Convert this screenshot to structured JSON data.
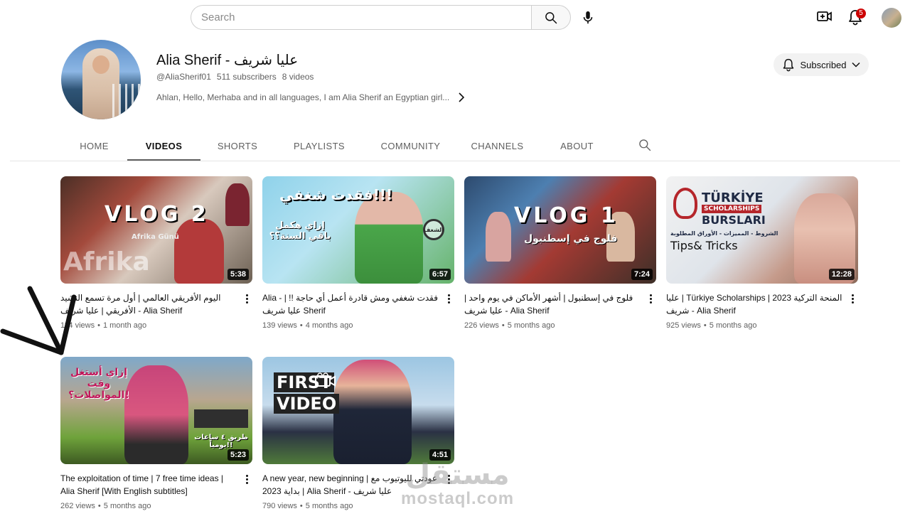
{
  "topbar": {
    "search_placeholder": "Search",
    "notification_count": "5",
    "icons": [
      "search-icon",
      "microphone-icon",
      "create-video-icon",
      "bell-icon",
      "avatar"
    ]
  },
  "channel": {
    "name": "Alia Sherif - عليا شريف",
    "handle": "@AliaSherif01",
    "subscribers": "511 subscribers",
    "videos_count": "8 videos",
    "description": "Ahlan, Hello, Merhaba and in all languages, I am Alia Sherif an Egyptian girl...",
    "subscribe_label": "Subscribed"
  },
  "tabs": [
    {
      "label": "HOME"
    },
    {
      "label": "VIDEOS"
    },
    {
      "label": "SHORTS"
    },
    {
      "label": "PLAYLISTS"
    },
    {
      "label": "COMMUNITY"
    },
    {
      "label": "CHANNELS"
    },
    {
      "label": "ABOUT"
    }
  ],
  "active_tab": "VIDEOS",
  "videos": [
    {
      "title": "اليوم الأفريقي العالمي | أول مرة تسمع النشيد الأفريقي | عليا شريف - Alia Sherif",
      "views": "114 views",
      "age": "1 month ago",
      "duration": "5:38",
      "thumb_text": [
        "VLOG 2",
        "Afrika",
        "Afrika Günü"
      ]
    },
    {
      "title": "Alia - فقدت شغفي ومش قادرة أعمل أي حاجة !! | عليا شريف Sherif",
      "views": "139 views",
      "age": "4 months ago",
      "duration": "6:57",
      "thumb_text": [
        "فقدت شغفي!!!",
        "إزاي هكمل باقي السنة؟؟",
        "الشغف"
      ]
    },
    {
      "title": "فلوج في إسطنبول | أشهر الأماكن في يوم واحد | عليا شريف - Alia Sherif",
      "views": "226 views",
      "age": "5 months ago",
      "duration": "7:24",
      "thumb_text": [
        "VLOG 1",
        "فلوج في إسطنبول"
      ]
    },
    {
      "title": "عليا | Türkiye Scholarships | المنحة التركية 2023 شريف - Alia Sherif",
      "views": "925 views",
      "age": "5 months ago",
      "duration": "12:28",
      "thumb_text": [
        "TÜRKİYE",
        "SCHOLARSHIPS",
        "BURSLARI",
        "الشروط - المميزات - الأوراق المطلوبة",
        "Tips& Tricks"
      ]
    },
    {
      "title": "The exploitation of time | 7 free time ideas | Alia Sherif [With English subtitles]",
      "views": "262 views",
      "age": "5 months ago",
      "duration": "5:23",
      "thumb_text": [
        "إزاي أستغل وقت المواصلات؟!",
        "طريق ٤ ساعات يومياً!!"
      ]
    },
    {
      "title": "A new year, new beginning | عودتي لليوتيوب مع بداية 2023 | Alia Sherif - عليا شريف",
      "views": "790 views",
      "age": "5 months ago",
      "duration": "4:51",
      "thumb_text": [
        "FIRST",
        "VIDEO"
      ]
    }
  ],
  "watermark": {
    "arabic": "مستقل",
    "latin": "mostaql.com"
  },
  "colors": {
    "badge": "#cc0000",
    "text_secondary": "#606060",
    "subscribe_bg": "#f2f2f2"
  }
}
